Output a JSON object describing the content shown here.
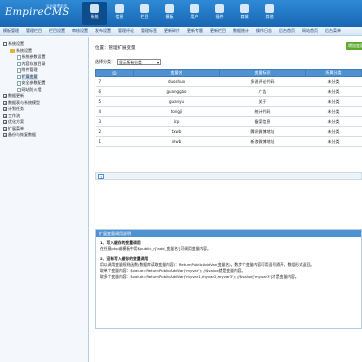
{
  "header": {
    "logo": "EmpireCMS",
    "sub": "后台管理系统",
    "nav": [
      "系统",
      "信息",
      "栏目",
      "模板",
      "用户",
      "插件",
      "商城",
      "其他"
    ],
    "active_index": 0
  },
  "subnav": [
    "模板管理",
    "管理栏目",
    "栏目设置",
    "审核设置",
    "发布设置",
    "管理评论",
    "管理标签",
    "更新碎片",
    "更新专题",
    "更新栏目",
    "数据统计",
    "操作日志",
    "后台首页",
    "网站首页",
    "后台菜单"
  ],
  "sidebar": {
    "items": [
      {
        "label": "系统设置",
        "depth": 0,
        "kind": "box",
        "mark": "-"
      },
      {
        "label": "系统设置",
        "depth": 1,
        "kind": "fold"
      },
      {
        "label": "系统参数设置",
        "depth": 2,
        "kind": "doc"
      },
      {
        "label": "内容存放目录",
        "depth": 2,
        "kind": "doc"
      },
      {
        "label": "附件管理",
        "depth": 2,
        "kind": "doc"
      },
      {
        "label": "扩展变量",
        "depth": 2,
        "kind": "doc",
        "highlight": true
      },
      {
        "label": "安全参数配置",
        "depth": 2,
        "kind": "doc"
      },
      {
        "label": "网站防火墙",
        "depth": 2,
        "kind": "doc"
      },
      {
        "label": "数据更新",
        "depth": 0,
        "kind": "box",
        "mark": "+"
      },
      {
        "label": "数据表与系统模型",
        "depth": 0,
        "kind": "box",
        "mark": "+"
      },
      {
        "label": "计划任务",
        "depth": 0,
        "kind": "box",
        "mark": "+"
      },
      {
        "label": "工作流",
        "depth": 0,
        "kind": "box",
        "mark": "+"
      },
      {
        "label": "优化方案",
        "depth": 0,
        "kind": "box",
        "mark": "+"
      },
      {
        "label": "扩展菜单",
        "depth": 0,
        "kind": "box",
        "mark": "+"
      },
      {
        "label": "备份与恢复数据",
        "depth": 0,
        "kind": "box",
        "mark": "+"
      }
    ]
  },
  "main": {
    "location": "位置：管理扩展变量",
    "add_button": "增加变量",
    "filter_label": "选择分类：",
    "filter_value": "显示所有分类",
    "columns": [
      "ID",
      "变量名",
      "变量标识",
      "所属分类"
    ],
    "rows": [
      [
        "7",
        "duoshuo",
        "多说评论代码",
        "未分类"
      ],
      [
        "6",
        "guanggao",
        "广告",
        "未分类"
      ],
      [
        "5",
        "guanyu",
        "关于",
        "未分类"
      ],
      [
        "4",
        "tongji",
        "统计代码",
        "未分类"
      ],
      [
        "3",
        "icp",
        "备案信息",
        "未分类"
      ],
      [
        "2",
        "txwb",
        "腾讯微博地址",
        "未分类"
      ],
      [
        "1",
        "xlwb",
        "新浪微博地址",
        "未分类"
      ]
    ],
    "pager": "7",
    "help": {
      "title": "扩展变量调用说明",
      "h1": "1、写入缓存的变量调用",
      "p1": "在任意php或模板中用$public_r['add_变量名']可调用变量内容。",
      "h2": "2、没有写入缓存的变量调用",
      "p2a": "用以调用变量规则函数(数据库读取变量内容)：ReturnPublicAddVar(变量名)，数步个变量内容可用逗号隔开，数组形式返回。",
      "p2b": "取单个变量内容：$value=ReturnPublicAddVar('myvar'); //$value就是变量内容。",
      "p2c": "取多个变量内容：$value=ReturnPublicAddVar('myvar1,myvar2,myvar3'); //$value['myvar3']才是变量内容。"
    }
  }
}
